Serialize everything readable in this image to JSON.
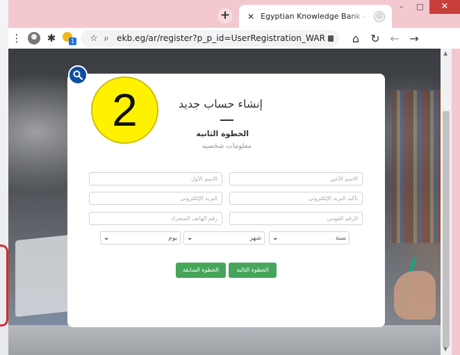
{
  "browser": {
    "new_tab_symbol": "+",
    "tab": {
      "close_symbol": "✕",
      "title": "Egyptian Knowledge Bank - Regi"
    },
    "window_controls": {
      "minimize": "–",
      "maximize": "□",
      "close": "✕"
    },
    "toolbar": {
      "menu_symbol": "⋮",
      "puzzle_symbol": "✱",
      "extension_badge": "1",
      "bookmark_symbol": "☆",
      "search_symbol": "⌕",
      "url": "ekb.eg/ar/register?p_p_id=UserRegistration_WAR_E...",
      "home_symbol": "⌂",
      "reload_symbol": "↻",
      "back_symbol": "←",
      "forward_symbol": "→"
    }
  },
  "page": {
    "step_number": "2",
    "title": "إنشاء حساب جديد",
    "step_label": "الخطوة الثانية",
    "step_sub": "معلومات شخصيه",
    "fields": {
      "last_name": {
        "placeholder": "الاسم الأخير"
      },
      "first_name": {
        "placeholder": "الاسم الأول"
      },
      "email_confirm": {
        "placeholder": "تأكيد البريد الإلكتروني"
      },
      "email": {
        "placeholder": "البريد الإلكتروني"
      },
      "national_id": {
        "placeholder": "الرقم القومي"
      },
      "mobile": {
        "placeholder": "رقم الهاتف المتحرك"
      }
    },
    "selects": {
      "year": {
        "value": "سنة"
      },
      "month": {
        "value": "شهر"
      },
      "day": {
        "value": "يوم"
      }
    },
    "buttons": {
      "next": "الخطوة التالية",
      "previous": "الخطوة السابقة"
    }
  },
  "colors": {
    "tabstrip": "#f3c8cf",
    "primary_button": "#45a65a",
    "step_circle": "#fff200",
    "search_fab": "#0e4ea0",
    "close_button": "#c83e3a"
  }
}
